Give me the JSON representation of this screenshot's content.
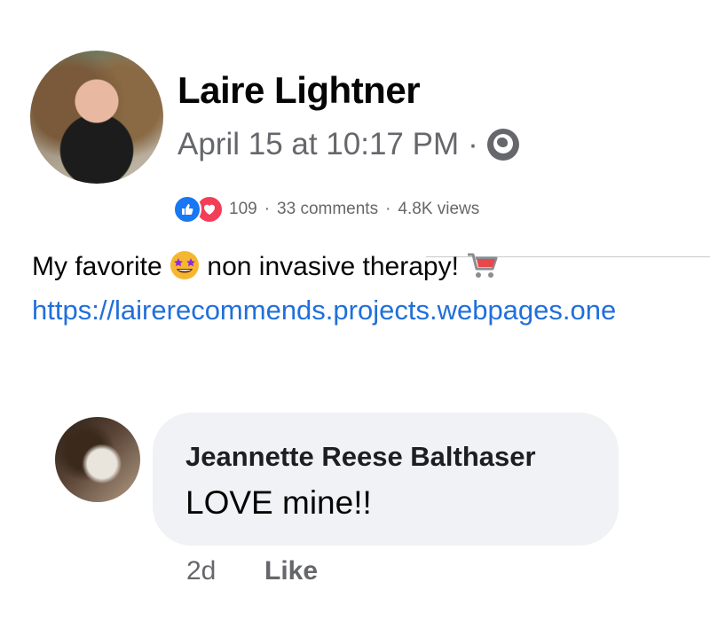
{
  "post": {
    "author": "Laire Lightner",
    "timestamp": "April 15 at 10:17 PM",
    "separator": "·",
    "privacy_icon": "globe-icon",
    "reactions": {
      "types": [
        "like",
        "love"
      ],
      "count": "109",
      "comments": "33 comments",
      "views": "4.8K views"
    },
    "text_before_emoji": "My favorite",
    "text_after_emoji": "non invasive therapy!",
    "emojis": [
      "star-struck-emoji",
      "shopping-cart-emoji"
    ],
    "link": "https://lairerecommends.projects.webpages.one"
  },
  "comment": {
    "author": "Jeannette Reese Balthaser",
    "text": "LOVE mine!!",
    "time": "2d",
    "like_label": "Like"
  },
  "colors": {
    "link": "#216fdb",
    "secondary_text": "#65676b",
    "like_blue": "#1877f2",
    "love_red": "#f33e58",
    "bubble_bg": "#f0f2f5"
  }
}
